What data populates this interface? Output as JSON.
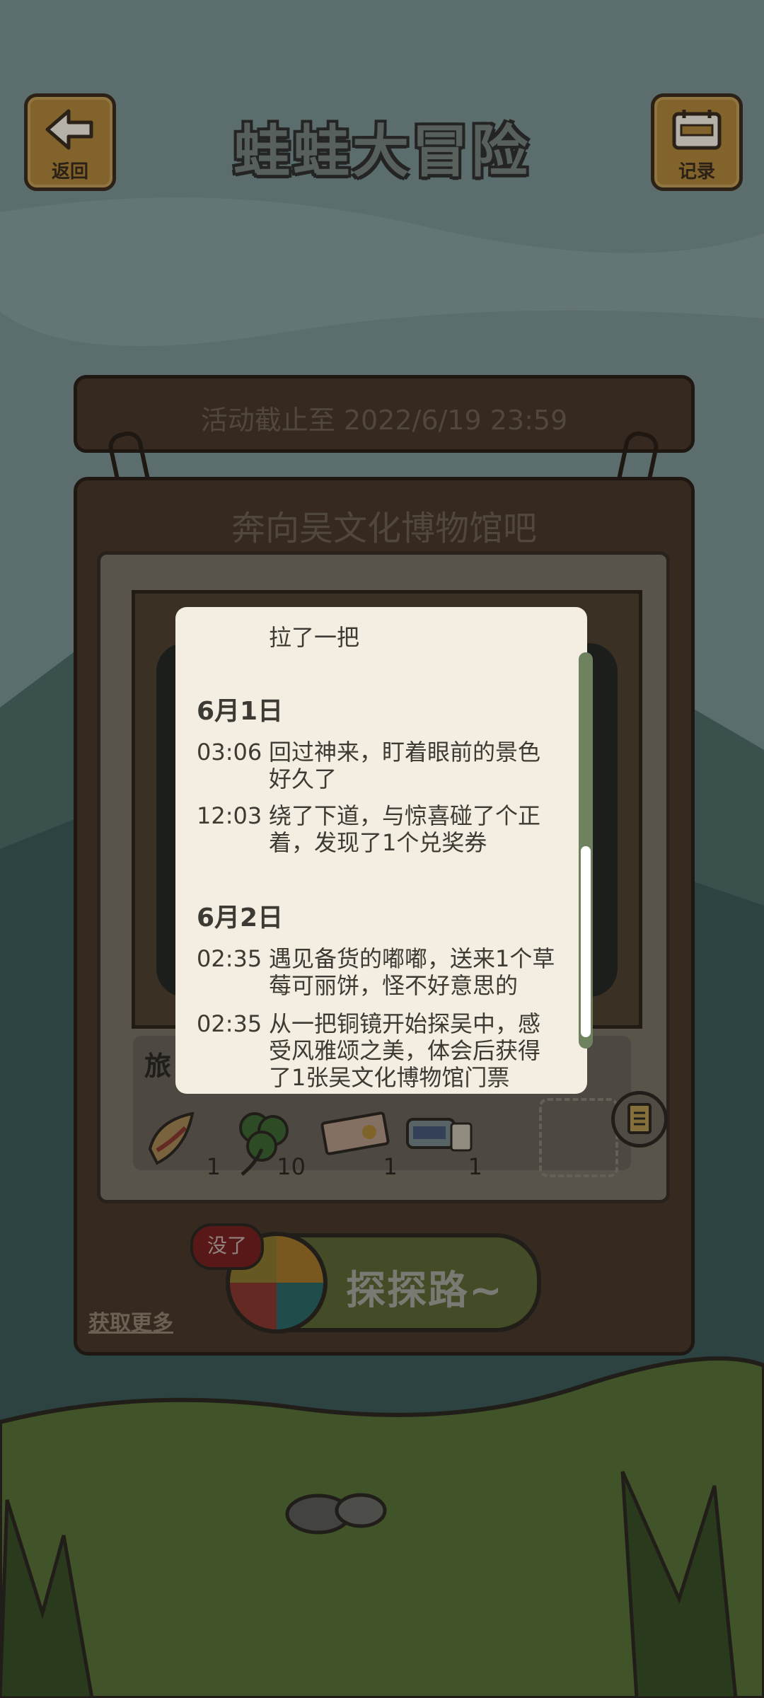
{
  "header": {
    "title": "蛙蛙大冒险",
    "back_label": "返回",
    "log_label": "记录"
  },
  "event": {
    "deadline": "活动截止至 2022/6/19 23:59",
    "board_title": "奔向吴文化博物馆吧"
  },
  "travel": {
    "label": "旅",
    "items": [
      {
        "icon": "pastry-icon",
        "count": "1"
      },
      {
        "icon": "clover-icon",
        "count": "10"
      },
      {
        "icon": "ticket-icon",
        "count": "1"
      },
      {
        "icon": "pass-card-icon",
        "count": "1"
      }
    ]
  },
  "explore": {
    "label": "探探路~",
    "badge": "没了",
    "get_more": "获取更多"
  },
  "log": {
    "top_fragment": "拉了一把",
    "days": [
      {
        "date": "6月1日",
        "entries": [
          {
            "time": "03:06",
            "text": "回过神来，盯着眼前的景色好久了"
          },
          {
            "time": "12:03",
            "text": "绕了下道，与惊喜碰了个正着，发现了1个兑奖券"
          }
        ]
      },
      {
        "date": "6月2日",
        "entries": [
          {
            "time": "02:35",
            "text": "遇见备货的嘟嘟，送来1个草莓可丽饼，怪不好意思的"
          },
          {
            "time": "02:35",
            "text": "从一把铜镜开始探吴中，感受风雅颂之美，体会后获得了1张吴文化博物馆门票"
          }
        ]
      }
    ]
  },
  "colors": {
    "wood": "#4b3a2d",
    "paper": "#f3eee1",
    "scroll_track": "#6f8260"
  }
}
